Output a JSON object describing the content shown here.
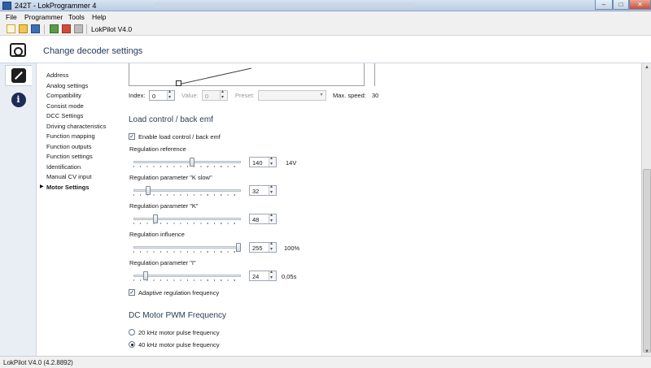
{
  "window": {
    "title": "242T - LokProgrammer 4",
    "minimize": "–",
    "maximize": "□",
    "close": "✕"
  },
  "menu": [
    "File",
    "Programmer",
    "Tools",
    "Help"
  ],
  "toolbar": {
    "label": "LokPilot V4.0"
  },
  "header": {
    "title": "Change decoder settings"
  },
  "nav": {
    "items": [
      "Address",
      "Analog settings",
      "Compatibility",
      "Consist mode",
      "DCC Settings",
      "Driving characteristics",
      "Function mapping",
      "Function outputs",
      "Function settings",
      "Identification",
      "Manual CV input",
      "Motor Settings"
    ],
    "selected_index": 11
  },
  "speed_table": {
    "index_label": "Index:",
    "index_value": "0",
    "value_label": "Value:",
    "value_value": "0",
    "preset_label": "Preset:",
    "preset_value": "",
    "max_speed_label": "Max. speed:",
    "max_speed_value": "30"
  },
  "load_control": {
    "title": "Load control / back emf",
    "enable_label": "Enable load control / back emf",
    "enable_checked": true,
    "params": [
      {
        "label": "Regulation reference",
        "value": "140",
        "unit": "14V",
        "fraction": 0.55
      },
      {
        "label": "Regulation parameter \"K slow\"",
        "value": "32",
        "unit": "",
        "fraction": 0.125
      },
      {
        "label": "Regulation parameter \"K\"",
        "value": "48",
        "unit": "",
        "fraction": 0.19
      },
      {
        "label": "Regulation influence",
        "value": "255",
        "unit": "100%",
        "fraction": 1.0
      },
      {
        "label": "Regulation parameter \"I\"",
        "value": "24",
        "unit": "0,05s",
        "fraction": 0.094
      }
    ],
    "adaptive_label": "Adaptive regulation frequency",
    "adaptive_checked": true
  },
  "pwm": {
    "title": "DC Motor PWM Frequency",
    "options": [
      "20 kHz motor pulse frequency",
      "40 kHz motor pulse frequency"
    ],
    "selected_index": 1
  },
  "status": {
    "text": "LokPilot V4.0 (4.2.8892)"
  }
}
